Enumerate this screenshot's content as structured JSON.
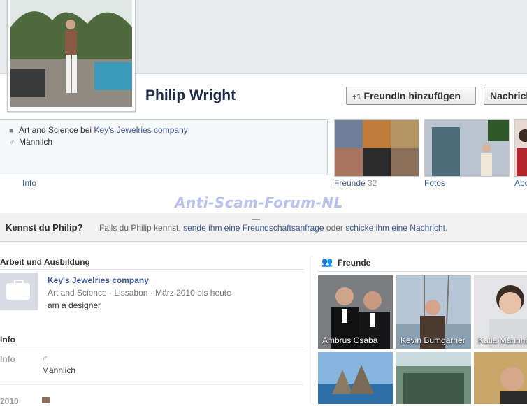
{
  "profile": {
    "name": "Philip Wright",
    "add_friend_label": "FreundIn hinzufügen",
    "message_label": "Nachricht",
    "work_line_prefix": "Art and Science bei",
    "work_line_company": "Key's Jewelries company",
    "gender": "Männlich"
  },
  "tabs": {
    "info": "Info",
    "friends": "Freunde",
    "friends_count": "32",
    "photos": "Fotos",
    "about": "Abo"
  },
  "watermark": "Anti-Scam-Forum-NL",
  "know_bar": {
    "title": "Kennst du Philip?",
    "text1": "Falls du Philip kennst,",
    "link1": "sende ihm eine Freundschaftsanfrage",
    "text2": "oder",
    "link2": "schicke ihm eine Nachricht",
    "text3": "."
  },
  "work": {
    "heading": "Arbeit und Ausbildung",
    "company": "Key's Jewelries company",
    "details": "Art and Science · Lissabon · März 2010 bis heute",
    "note": "am a designer"
  },
  "info": {
    "heading": "Info",
    "label": "Info",
    "gender": "Männlich",
    "year": "2010"
  },
  "friends_box": {
    "heading": "Freunde",
    "items": [
      {
        "name": "Ambrus Csaba"
      },
      {
        "name": "Kevin Bumgarner"
      },
      {
        "name": "Katia Marinho"
      }
    ]
  },
  "colors": {
    "link": "#3b5998",
    "name": "#1c2a47",
    "watermark": "#b8c1ee"
  }
}
